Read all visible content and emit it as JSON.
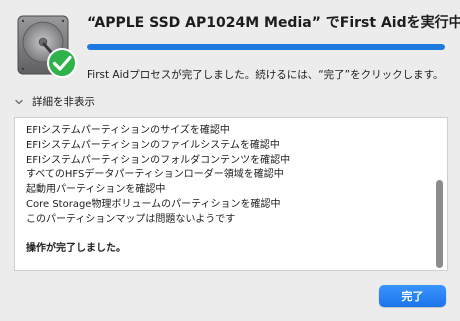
{
  "dialog": {
    "title": "“APPLE SSD AP1024M Media” でFirst Aidを実行中",
    "progress": 1.0,
    "message": "First Aidプロセスが完了しました。続けるには、“完了”をクリックします。",
    "details_toggle_label": "詳細を非表示",
    "done_button_label": "完了",
    "icons": {
      "disk": "disk-icon",
      "status": "checkmark-icon",
      "toggle": "chevron-down-icon"
    },
    "colors": {
      "accent": "#1f7ae0",
      "check_green": "#2fb24a"
    }
  },
  "log": {
    "lines": [
      "EFIシステムパーティションのサイズを確認中",
      "EFIシステムパーティションのファイルシステムを確認中",
      "EFIシステムパーティションのフォルダコンテンツを確認中",
      "すべてのHFSデータパーティションローダー領域を確認中",
      "起動用パーティションを確認中",
      "Core Storage物理ボリュームのパーティションを確認中",
      "このパーティションマップは問題ないようです",
      "",
      "操作が完了しました。"
    ]
  }
}
